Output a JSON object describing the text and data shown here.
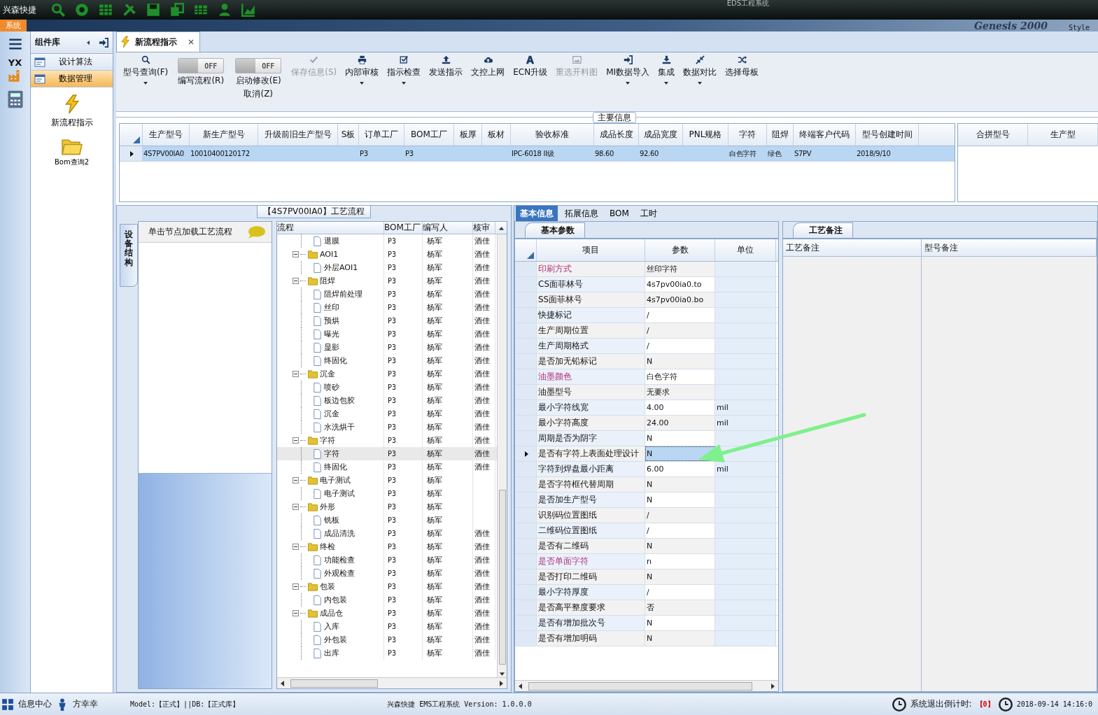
{
  "title_bar": {
    "app_name": "兴森快捷",
    "title": "EDS工程系统"
  },
  "menu_bar": {
    "menu": "系统",
    "brand": "Genesis 2000",
    "style_label": "Style"
  },
  "side_strip": {
    "logo_text": "YX"
  },
  "nav": {
    "title": "组件库",
    "items": [
      {
        "label": "设计算法",
        "selected": false
      },
      {
        "label": "数据管理",
        "selected": true
      }
    ],
    "tiles": [
      "新流程指示",
      "Bom查询2"
    ]
  },
  "document_tab": {
    "label": "新流程指示"
  },
  "toolbar": [
    {
      "kind": "button",
      "label": "型号查询(F)",
      "menu": true,
      "disabled": false
    },
    {
      "kind": "toggle",
      "label": "编写流程(R)",
      "switch_text": "OFF",
      "on": false
    },
    {
      "kind": "toggle",
      "label": "启动修改(E)",
      "sublabel": "取消(Z)",
      "switch_text": "OFF",
      "on": false
    },
    {
      "kind": "button",
      "label": "保存信息(S)",
      "menu": false,
      "disabled": true
    },
    {
      "kind": "button",
      "label": "内部审核",
      "menu": true,
      "disabled": false
    },
    {
      "kind": "button",
      "label": "指示检查",
      "menu": true,
      "disabled": false
    },
    {
      "kind": "button",
      "label": "发送指示",
      "menu": false,
      "disabled": false
    },
    {
      "kind": "button",
      "label": "文控上网",
      "menu": false,
      "disabled": false
    },
    {
      "kind": "button",
      "label": "ECN升级",
      "menu": false,
      "disabled": false
    },
    {
      "kind": "button",
      "label": "重选开料图",
      "menu": false,
      "disabled": true
    },
    {
      "kind": "button",
      "label": "MI数据导入",
      "menu": true,
      "disabled": false
    },
    {
      "kind": "button",
      "label": "集成",
      "menu": true,
      "disabled": false
    },
    {
      "kind": "button",
      "label": "数据对比",
      "menu": true,
      "disabled": false
    },
    {
      "kind": "button",
      "label": "选择母板",
      "menu": false,
      "disabled": false
    }
  ],
  "main_info": {
    "legend": "主要信息",
    "columns": [
      "生产型号",
      "新生产型号",
      "升级前旧生产型号",
      "S板",
      "订单工厂",
      "BOM工厂",
      "板厚",
      "板材",
      "验收标准",
      "成品长度",
      "成品宽度",
      "PNL规格",
      "字符",
      "阻焊",
      "终端客户代码",
      "型号创建时间"
    ],
    "rows": [
      {
        "selected": true,
        "cells": [
          "4S7PV00IA0",
          "10010400120172",
          null,
          null,
          "P3",
          "P3",
          null,
          null,
          "IPC-6018 II级",
          "98.60",
          "92.60",
          null,
          "白色字符",
          "绿色",
          "S7PV",
          "2018/9/10"
        ]
      }
    ],
    "merge_table": {
      "columns": [
        "合拼型号",
        "生产型"
      ]
    }
  },
  "process_tree": {
    "title": "【4S7PV00IA0】工艺流程",
    "side_tab": "设备结构",
    "hint": "单击节点加载工艺流程",
    "columns": [
      "流程",
      "BOM工厂",
      "编写人",
      "核审"
    ],
    "continued": [
      {
        "kind": "step",
        "name": "退膜",
        "bom": "P3",
        "author": "杨军",
        "reviewer": "酒佳",
        "selected": false
      }
    ],
    "nodes": [
      {
        "kind": "folder",
        "name": "AOI1",
        "bom": "P3",
        "author": "杨军",
        "reviewer": "酒佳",
        "expanded": true,
        "selected": false,
        "children": [
          {
            "kind": "step",
            "name": "外层AOI1",
            "bom": "P3",
            "author": "杨军",
            "reviewer": "酒佳",
            "selected": false
          }
        ]
      },
      {
        "kind": "folder",
        "name": "阻焊",
        "bom": "P3",
        "author": "杨军",
        "reviewer": "酒佳",
        "expanded": true,
        "selected": false,
        "children": [
          {
            "kind": "step",
            "name": "阻焊前处理",
            "bom": "P3",
            "author": "杨军",
            "reviewer": "酒佳",
            "selected": false
          },
          {
            "kind": "step",
            "name": "丝印",
            "bom": "P3",
            "author": "杨军",
            "reviewer": "酒佳",
            "selected": false
          },
          {
            "kind": "step",
            "name": "预烘",
            "bom": "P3",
            "author": "杨军",
            "reviewer": "酒佳",
            "selected": false
          },
          {
            "kind": "step",
            "name": "曝光",
            "bom": "P3",
            "author": "杨军",
            "reviewer": "酒佳",
            "selected": false
          },
          {
            "kind": "step",
            "name": "显影",
            "bom": "P3",
            "author": "杨军",
            "reviewer": "酒佳",
            "selected": false
          },
          {
            "kind": "step",
            "name": "终固化",
            "bom": "P3",
            "author": "杨军",
            "reviewer": "酒佳",
            "selected": false
          }
        ]
      },
      {
        "kind": "folder",
        "name": "沉金",
        "bom": "P3",
        "author": "杨军",
        "reviewer": "酒佳",
        "expanded": true,
        "selected": false,
        "children": [
          {
            "kind": "step",
            "name": "喷砂",
            "bom": "P3",
            "author": "杨军",
            "reviewer": "酒佳",
            "selected": false
          },
          {
            "kind": "step",
            "name": "板边包胶",
            "bom": "P3",
            "author": "杨军",
            "reviewer": "酒佳",
            "selected": false
          },
          {
            "kind": "step",
            "name": "沉金",
            "bom": "P3",
            "author": "杨军",
            "reviewer": "酒佳",
            "selected": false
          },
          {
            "kind": "step",
            "name": "水洗烘干",
            "bom": "P3",
            "author": "杨军",
            "reviewer": "酒佳",
            "selected": false
          }
        ]
      },
      {
        "kind": "folder",
        "name": "字符",
        "bom": "P3",
        "author": "杨军",
        "reviewer": "酒佳",
        "expanded": true,
        "selected": false,
        "children": [
          {
            "kind": "step",
            "name": "字符",
            "bom": "P3",
            "author": "杨军",
            "reviewer": "酒佳",
            "selected": true
          },
          {
            "kind": "step",
            "name": "终固化",
            "bom": "P3",
            "author": "杨军",
            "reviewer": "酒佳",
            "selected": false
          }
        ]
      },
      {
        "kind": "folder",
        "name": "电子测试",
        "bom": "P3",
        "author": "杨军",
        "expanded": true,
        "selected": false,
        "children": [
          {
            "kind": "step",
            "name": "电子测试",
            "bom": "P3",
            "author": "杨军",
            "selected": false
          }
        ]
      },
      {
        "kind": "folder",
        "name": "外形",
        "bom": "P3",
        "author": "杨军",
        "expanded": true,
        "selected": false,
        "children": [
          {
            "kind": "step",
            "name": "铣板",
            "bom": "P3",
            "author": "杨军",
            "selected": false
          },
          {
            "kind": "step",
            "name": "成品清洗",
            "bom": "P3",
            "author": "杨军",
            "reviewer": "酒佳",
            "selected": false
          }
        ]
      },
      {
        "kind": "folder",
        "name": "终检",
        "bom": "P3",
        "author": "杨军",
        "reviewer": "酒佳",
        "expanded": true,
        "selected": false,
        "children": [
          {
            "kind": "step",
            "name": "功能检查",
            "bom": "P3",
            "author": "杨军",
            "reviewer": "酒佳",
            "selected": false
          },
          {
            "kind": "step",
            "name": "外观检查",
            "bom": "P3",
            "author": "杨军",
            "reviewer": "酒佳",
            "selected": false
          }
        ]
      },
      {
        "kind": "folder",
        "name": "包装",
        "bom": "P3",
        "author": "杨军",
        "reviewer": "酒佳",
        "expanded": true,
        "selected": false,
        "children": [
          {
            "kind": "step",
            "name": "内包装",
            "bom": "P3",
            "author": "杨军",
            "reviewer": "酒佳",
            "selected": false
          }
        ]
      },
      {
        "kind": "folder",
        "name": "成品仓",
        "bom": "P3",
        "author": "杨军",
        "reviewer": "酒佳",
        "expanded": true,
        "selected": false,
        "children": [
          {
            "kind": "step",
            "name": "入库",
            "bom": "P3",
            "author": "杨军",
            "reviewer": "酒佳",
            "selected": false
          },
          {
            "kind": "step",
            "name": "外包装",
            "bom": "P3",
            "author": "杨军",
            "reviewer": "酒佳",
            "selected": false
          },
          {
            "kind": "step",
            "name": "出库",
            "bom": "P3",
            "author": "杨军",
            "reviewer": "酒佳",
            "selected": false
          }
        ]
      }
    ]
  },
  "detail_tabs": [
    {
      "label": "基本信息",
      "selected": true
    },
    {
      "label": "拓展信息",
      "selected": false
    },
    {
      "label": "BOM",
      "selected": false
    },
    {
      "label": "工时",
      "selected": false
    }
  ],
  "params": {
    "tab": "基本参数",
    "columns": [
      "项目",
      "参数",
      "单位"
    ],
    "rows": [
      {
        "item": "印刷方式",
        "value": "丝印字符",
        "flagged": true,
        "selected": false
      },
      {
        "item": "CS面菲林号",
        "value": "4s7pv00ia0.to",
        "flagged": false,
        "selected": false
      },
      {
        "item": "SS面菲林号",
        "value": "4s7pv00ia0.bo",
        "flagged": false,
        "selected": false
      },
      {
        "item": "快捷标记",
        "value": "/",
        "flagged": false,
        "selected": false
      },
      {
        "item": "生产周期位置",
        "value": "/",
        "flagged": false,
        "selected": false
      },
      {
        "item": "生产周期格式",
        "value": "/",
        "flagged": false,
        "selected": false
      },
      {
        "item": "是否加无铅标记",
        "value": "N",
        "flagged": false,
        "selected": false
      },
      {
        "item": "油墨颜色",
        "value": "白色字符",
        "flagged": true,
        "selected": false
      },
      {
        "item": "油墨型号",
        "value": "无要求",
        "flagged": false,
        "selected": false
      },
      {
        "item": "最小字符线宽",
        "value": "4.00",
        "unit": "mil",
        "flagged": false,
        "selected": false
      },
      {
        "item": "最小字符高度",
        "value": "24.00",
        "unit": "mil",
        "flagged": false,
        "selected": false
      },
      {
        "item": "周期是否为阴字",
        "value": "N",
        "flagged": false,
        "selected": false
      },
      {
        "item": "是否有字符上表面处理设计",
        "value": "N",
        "flagged": false,
        "selected": true
      },
      {
        "item": "字符到焊盘最小距离",
        "value": "6.00",
        "unit": "mil",
        "flagged": false,
        "selected": false
      },
      {
        "item": "是否字符框代替周期",
        "value": "N",
        "flagged": false,
        "selected": false
      },
      {
        "item": "是否加生产型号",
        "value": "N",
        "flagged": false,
        "selected": false
      },
      {
        "item": "识别码位置图纸",
        "value": "/",
        "flagged": false,
        "selected": false
      },
      {
        "item": "二维码位置图纸",
        "value": "/",
        "flagged": false,
        "selected": false
      },
      {
        "item": "是否有二维码",
        "value": "N",
        "flagged": false,
        "selected": false
      },
      {
        "item": "是否单面字符",
        "value": "n",
        "flagged": true,
        "selected": false
      },
      {
        "item": "是否打印二维码",
        "value": "N",
        "flagged": false,
        "selected": false
      },
      {
        "item": "最小字符厚度",
        "value": "/",
        "flagged": false,
        "selected": false
      },
      {
        "item": "是否高平整度要求",
        "value": "否",
        "flagged": false,
        "selected": false
      },
      {
        "item": "是否有增加批次号",
        "value": "N",
        "flagged": false,
        "selected": false
      },
      {
        "item": "是否有增加明码",
        "value": "N",
        "flagged": false,
        "selected": false
      }
    ]
  },
  "notes": {
    "tab": "工艺备注",
    "columns": [
      "工艺备注",
      "型号备注"
    ]
  },
  "status_bar": {
    "info_center": "信息中心",
    "user": "方幸幸",
    "model": "Model:【正式】||DB:【正式库】",
    "version": "兴森快捷 EMS工程系统 Version: 1.0.0.0",
    "countdown_label": "系统退出倒计时:",
    "countdown_value": "【0】",
    "datetime": "2018-09-14 14:16:0"
  }
}
